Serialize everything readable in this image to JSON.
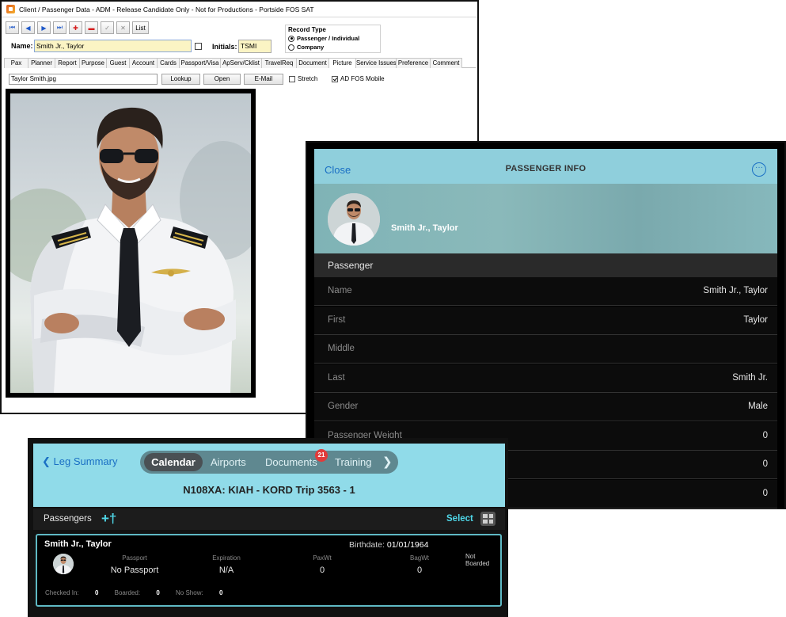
{
  "desktop": {
    "title": "Client / Passenger Data - ADM - Release Candidate Only - Not for Productions - Portside FOS SAT",
    "toolbar": [
      {
        "name": "first-record-button",
        "icon": "first-icon",
        "glyph": "⏮",
        "cls": "blue"
      },
      {
        "name": "prev-record-button",
        "icon": "prev-icon",
        "glyph": "◀",
        "cls": "blue"
      },
      {
        "name": "next-record-button",
        "icon": "next-icon",
        "glyph": "▶",
        "cls": "blue"
      },
      {
        "name": "last-record-button",
        "icon": "last-icon",
        "glyph": "⏭",
        "cls": "blue"
      },
      {
        "name": "add-record-button",
        "icon": "plus-icon",
        "glyph": "✚",
        "cls": "red"
      },
      {
        "name": "delete-record-button",
        "icon": "minus-icon",
        "glyph": "▬",
        "cls": "red"
      },
      {
        "name": "post-record-button",
        "icon": "check-icon",
        "glyph": "✓",
        "cls": "grey"
      },
      {
        "name": "cancel-record-button",
        "icon": "close-icon",
        "glyph": "✕",
        "cls": "grey"
      }
    ],
    "list_label": "List",
    "name_label": "Name:",
    "name_value": "Smith Jr., Taylor",
    "initials_label": "Initials:",
    "initials_value": "TSMI",
    "record_type": {
      "title": "Record Type",
      "options": [
        {
          "label": "Passenger / Individual",
          "selected": true
        },
        {
          "label": "Company",
          "selected": false
        }
      ]
    },
    "tabs": [
      {
        "label": "Pax",
        "w": 31
      },
      {
        "label": "Planner",
        "w": 35
      },
      {
        "label": "Report",
        "w": 32
      },
      {
        "label": "Purpose",
        "w": 35
      },
      {
        "label": "Guest",
        "w": 30
      },
      {
        "label": "Account",
        "w": 36
      },
      {
        "label": "Cards",
        "w": 29
      },
      {
        "label": "Passport/Visa",
        "w": 53
      },
      {
        "label": "ApServ/Cklist",
        "w": 53
      },
      {
        "label": "TravelReq",
        "w": 45
      },
      {
        "label": "Document",
        "w": 42
      },
      {
        "label": "Picture",
        "w": 35,
        "active": true
      },
      {
        "label": "Service Issues",
        "w": 52
      },
      {
        "label": "Preference",
        "w": 44
      },
      {
        "label": "Comment",
        "w": 41
      }
    ],
    "picture": {
      "file_name": "Taylor Smith.jpg",
      "lookup_label": "Lookup",
      "open_label": "Open",
      "email_label": "E-Mail",
      "stretch_label": "Stretch",
      "stretch_checked": false,
      "ad_label": "AD  FOS Mobile",
      "ad_checked": true
    }
  },
  "info": {
    "close_label": "Close",
    "title": "PASSENGER INFO",
    "more_glyph": "···",
    "passenger_name": "Smith Jr., Taylor",
    "section_label": "Passenger",
    "rows": [
      {
        "label": "Name",
        "value": "Smith Jr., Taylor"
      },
      {
        "label": "First",
        "value": "Taylor"
      },
      {
        "label": "Middle",
        "value": ""
      },
      {
        "label": "Last",
        "value": "Smith Jr."
      },
      {
        "label": "Gender",
        "value": "Male"
      },
      {
        "label": "Passenger Weight",
        "value": "0"
      },
      {
        "label": "",
        "value": "0"
      },
      {
        "label": "",
        "value": "0"
      }
    ]
  },
  "leg": {
    "back_label": "Leg Summary",
    "tabs": [
      "Calendar",
      "Airports",
      "Documents",
      "Training"
    ],
    "documents_badge": "21",
    "flight": "N108XA: KIAH - KORD  Trip 3563 - 1",
    "passengers_label": "Passengers",
    "select_label": "Select",
    "card": {
      "name": "Smith Jr., Taylor",
      "birthdate_label": "Birthdate:",
      "birthdate": "01/01/1964",
      "status": "Not Boarded",
      "columns": [
        {
          "header": "Passport",
          "value": "No Passport"
        },
        {
          "header": "Expiration",
          "value": "N/A"
        },
        {
          "header": "PaxWt",
          "value": "0"
        },
        {
          "header": "BagWt",
          "value": "0"
        }
      ],
      "checked_in_label": "Checked In:",
      "checked_in": "0",
      "boarded_label": "Boarded:",
      "boarded": "0",
      "no_show_label": "No Show:",
      "no_show": "0"
    }
  },
  "colors": {
    "accent_blue": "#1a6fc4",
    "header_cyan": "#8fcfdc",
    "leg_header_cyan": "#90dbe9",
    "select_cyan": "#4fd7e8",
    "field_yellow": "#fbf4c4",
    "badge_red": "#e13b3b"
  }
}
